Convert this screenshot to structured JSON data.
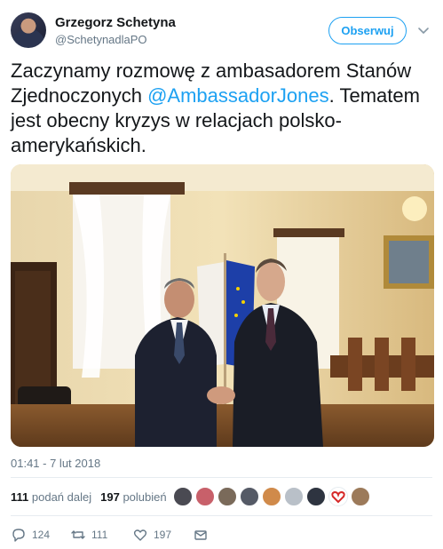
{
  "author": {
    "name": "Grzegorz Schetyna",
    "handle": "@SchetynadlaPO"
  },
  "follow_button": {
    "label": "Obserwuj"
  },
  "tweet": {
    "text_part1": "Zaczynamy rozmowę z ambasadorem Stanów Zjednoczonych ",
    "mention": "@AmbassadorJones",
    "text_part2": ". Tematem jest obecny kryzys w relacjach polsko-amerykańskich."
  },
  "timestamp": "01:41 - 7 lut 2018",
  "stats": {
    "retweets_count": "111",
    "retweets_label": "podań dalej",
    "likes_count": "197",
    "likes_label": "polubień"
  },
  "actions": {
    "reply_count": "124",
    "retweet_count": "111",
    "like_count": "197"
  },
  "colors": {
    "accent": "#1da1f2",
    "secondary_text": "#657786"
  }
}
